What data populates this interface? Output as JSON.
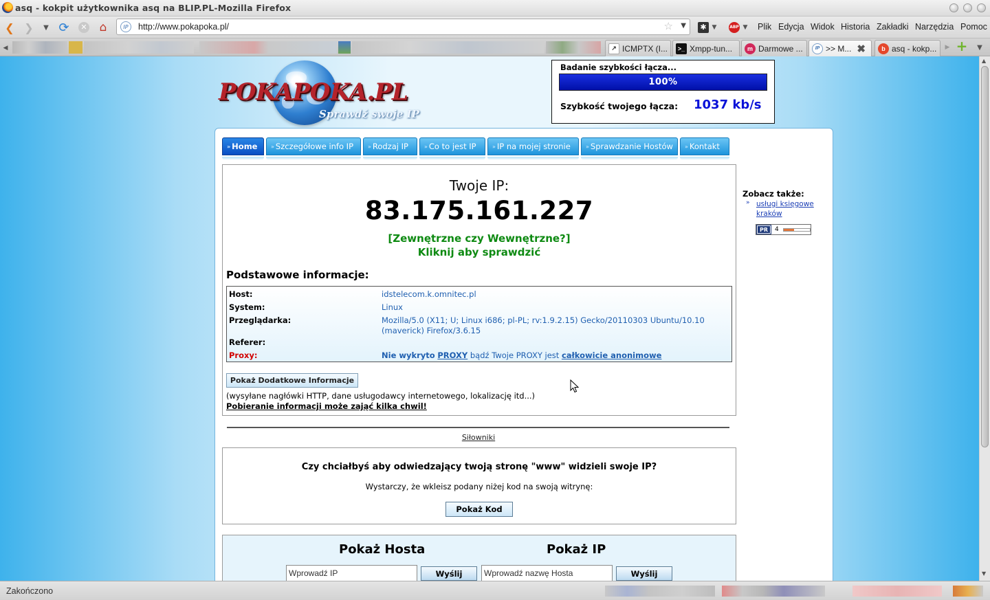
{
  "window": {
    "title": "asq - kokpit użytkownika asq na BLIP.PL-Mozilla Firefox"
  },
  "toolbar": {
    "url": "http://www.pokapoka.pl/",
    "menu": [
      "Plik",
      "Edycja",
      "Widok",
      "Historia",
      "Zakładki",
      "Narzędzia",
      "Pomoc"
    ]
  },
  "tabs": [
    {
      "label": "ICMPTX (I..."
    },
    {
      "label": "Xmpp-tun..."
    },
    {
      "label": "Darmowe ..."
    },
    {
      "label": ">> M..."
    },
    {
      "label": "asq - kokp..."
    }
  ],
  "logo": {
    "brand": "POKAPOKA.PL",
    "slogan": "Sprawdź swoje IP"
  },
  "speed": {
    "title": "Badanie szybkości łącza...",
    "progress_percent": 100,
    "progress_label": "100%",
    "label": "Szybkość twojego łącza:",
    "value": "1037 kb/s"
  },
  "nav": [
    "Home",
    "Szczegółowe info IP",
    "Rodzaj IP",
    "Co to jest IP",
    "IP na mojej stronie",
    "Sprawdzanie Hostów",
    "Kontakt"
  ],
  "ip": {
    "label": "Twoje IP:",
    "value": "83.175.161.227",
    "check_line1": "[Zewnętrzne czy Wewnętrzne?]",
    "check_line2": "Kliknij aby sprawdzić"
  },
  "basic": {
    "title": "Podstawowe informacje:",
    "host_label": "Host:",
    "host_value": "idstelecom.k.omnitec.pl",
    "system_label": "System:",
    "system_value": "Linux",
    "browser_label": "Przeglądarka:",
    "browser_value": "Mozilla/5.0 (X11; U; Linux i686; pl-PL; rv:1.9.2.15) Gecko/20110303 Ubuntu/10.10 (maverick) Firefox/3.6.15",
    "referer_label": "Referer:",
    "referer_value": "",
    "proxy_label": "Proxy:",
    "proxy_part1": "Nie wykryto",
    "proxy_link1": "PROXY",
    "proxy_part2": "bądź Twoje PROXY jest",
    "proxy_link2": "całkowicie anonimowe"
  },
  "more": {
    "button": "Pokaż Dodatkowe Informacje",
    "note": "(wysyłane nagłówki HTTP, dane usługodawcy internetowego, lokalizację itd...)",
    "warning": "Pobieranie informacji może zająć kilka chwil!"
  },
  "silowniki": "Siłowniki",
  "www": {
    "question": "Czy chciałbyś aby odwiedzający twoją stronę \"www\" widzieli swoje IP?",
    "note": "Wystarczy, że wkleisz podany niżej kod na swoją witrynę:",
    "button": "Pokaż Kod"
  },
  "forms": {
    "host_title": "Pokaż Hosta",
    "ip_title": "Pokaż IP",
    "ip_placeholder": "Wprowadź IP",
    "host_placeholder": "Wprowadź nazwę Hosta",
    "send": "Wyślij"
  },
  "sidebar": {
    "title": "Zobacz także:",
    "link": "usługi księgowe kraków",
    "pr_label": "PR",
    "pr_value": "4",
    "pr_fraction": 0.4
  },
  "status": "Zakończono"
}
